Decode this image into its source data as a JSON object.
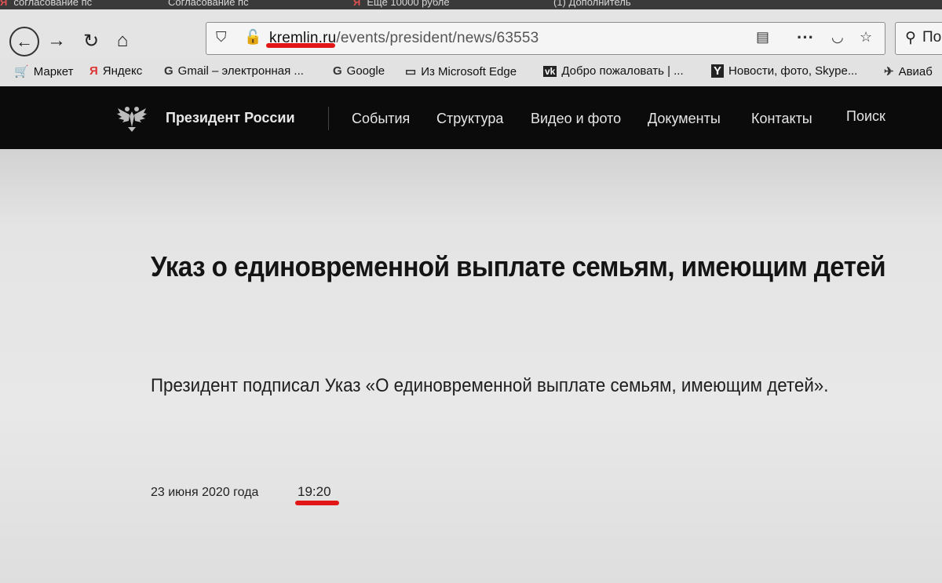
{
  "browser": {
    "tabs": [
      {
        "label": "согласование пс"
      },
      {
        "label": "Согласование пс"
      },
      {
        "label": "Еще 10000 рубле"
      },
      {
        "label": "(1) Дополнитель"
      }
    ],
    "url": {
      "domain": "kremlin.ru",
      "path": "/events/president/news/63553"
    },
    "search_placeholder": "По",
    "bookmarks": [
      {
        "label": "Маркет",
        "icon": "cart-icon"
      },
      {
        "label": "Яндекс",
        "icon": "yandex-icon"
      },
      {
        "label": "Gmail – электронная ...",
        "icon": "google-icon"
      },
      {
        "label": "Google",
        "icon": "google-icon"
      },
      {
        "label": "Из Microsoft Edge",
        "icon": "folder-icon"
      },
      {
        "label": "Добро пожаловать | ...",
        "icon": "vk-icon"
      },
      {
        "label": "Новости, фото, Skype...",
        "icon": "news-icon"
      },
      {
        "label": "Авиаб",
        "icon": "plane-icon"
      }
    ]
  },
  "site": {
    "title": "Президент России",
    "menu": [
      "События",
      "Структура",
      "Видео и фото",
      "Документы",
      "Контакты",
      "Поиск"
    ]
  },
  "article": {
    "headline": "Указ о единовременной выплате семьям, имеющим детей",
    "lead": "Президент подписал Указ «О единовременной выплате семьям, имеющим детей».",
    "date": "23 июня 2020 года",
    "time": "19:20"
  },
  "colors": {
    "header_bg": "#0b0b0b",
    "annotation_red": "#e21616"
  }
}
